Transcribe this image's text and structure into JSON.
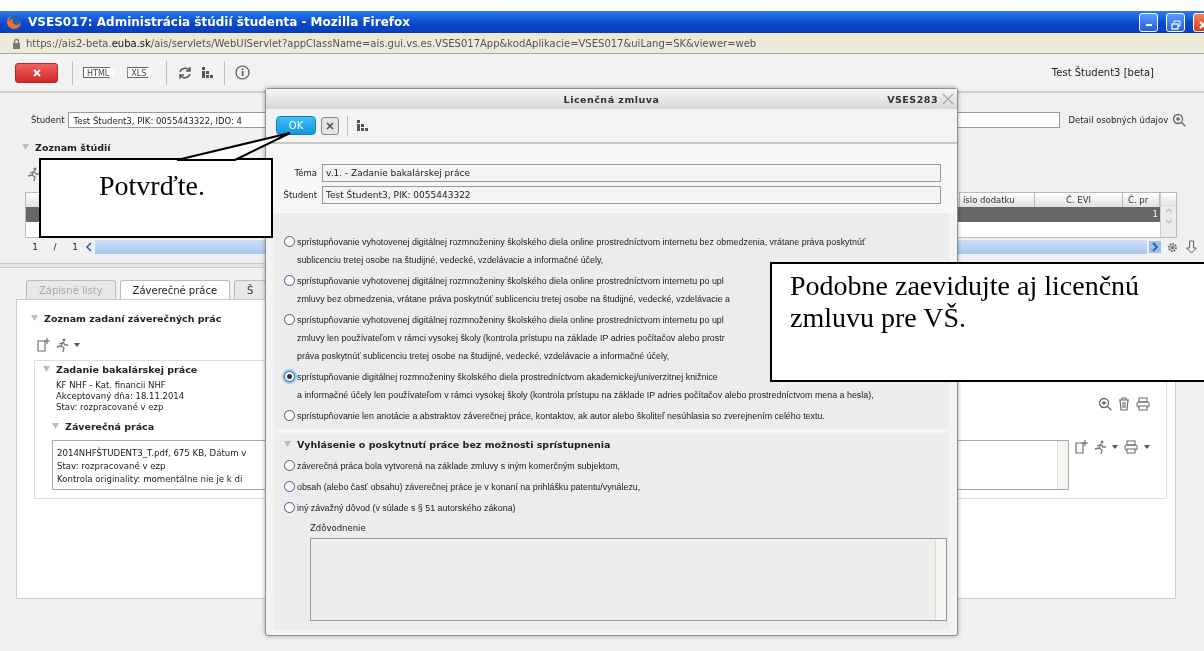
{
  "window": {
    "title": "VSES017: Administrácia štúdií študenta - Mozilla Firefox"
  },
  "address_bar": {
    "url": "https://ais2-beta.**euba.sk**/ais/servlets/WebUIServlet?appClassName=ais.gui.vs.es.VSES017App&kodAplikacie=VSES017&uiLang=SK&viewer=web"
  },
  "toolbar": {
    "items": [
      {
        "kind": "close"
      },
      {
        "kind": "separator"
      },
      {
        "kind": "tag",
        "label": "HTML"
      },
      {
        "kind": "tag",
        "label": "XLS"
      },
      {
        "kind": "separator"
      },
      {
        "kind": "refresh"
      },
      {
        "kind": "tree"
      },
      {
        "kind": "separator"
      },
      {
        "kind": "info"
      }
    ],
    "user": "Test Študent3 [beta]"
  },
  "student": {
    "label": "Študent",
    "value": "Test Študent3, PIK: 0055443322, IDO: 4",
    "detail_link": "Detail osobných údajov"
  },
  "studies": {
    "title": "Zoznam štúdií",
    "columns": [
      "íslo dodatku",
      "Č. EVI",
      "Č. pr"
    ],
    "rows": [
      {
        "column_3": "1",
        "selected": true
      },
      {
        "selected": false
      }
    ],
    "pager": {
      "page": "1",
      "separator": "/",
      "total": "1"
    }
  },
  "tabs": [
    {
      "label": "Zápisné listy",
      "selected": false,
      "disabled": true
    },
    {
      "label": "Záverečné práce",
      "selected": true,
      "disabled": false
    },
    {
      "label": "Š",
      "selected": false,
      "disabled": false
    }
  ],
  "theses": {
    "title": "Zoznam zadaní záverečných prác",
    "assignment": {
      "title": "Zadanie bakalárskej práce",
      "lines": [
        "KF NHF - Kat. financii NHF",
        "Akceptovaný dňa: 18.11.2014",
        "Stav: rozpracované v ezp"
      ],
      "thesis": {
        "title": "Záverečná práca",
        "lines": [
          "2014NHFŠTUDENT3_T.pdf, 675 KB, Dátum v",
          "Stav: rozpracované v ezp",
          "Kontrola originality: momentálne nie je k di"
        ]
      }
    }
  },
  "dialog": {
    "title": "Licenčná zmluva",
    "code": "VSES283",
    "ok_label": "OK",
    "fields": [
      {
        "label": "Téma",
        "value": "v.1. - Zadanie bakalárskej práce"
      },
      {
        "label": "Študent",
        "value": "Test Študent3, PIK: 0055443322"
      }
    ],
    "license_options": [
      {
        "selected": false,
        "lines": [
          "sprístupňovanie vyhotovenej digitálnej rozmnoženiny školského diela online prostredníctvom internetu bez obmedzenia, vrátane práva poskytnúť",
          "sublicenciu tretej osobe na študijné, vedecké, vzdelávacie a informačné účely,"
        ]
      },
      {
        "selected": false,
        "lines": [
          "sprístupňovanie vyhotovenej digitálnej rozmnoženiny školského diela online prostredníctvom internetu po upl",
          "zmluvy bez obmedzenia, vrátane práva poskytnúť sublicenciu tretej osobe na študijné, vedecké, vzdelávacie a"
        ]
      },
      {
        "selected": false,
        "lines": [
          "sprístupňovanie vyhotovenej digitálnej rozmnoženiny školského diela online prostredníctvom internetu po upl",
          "zmluvy len používateľom v rámci vysokej školy (kontrola prístupu na základe IP adries počítačov alebo prostr",
          "práva poskytnúť sublicenciu tretej osobe na študijné, vedecké, vzdelávacie a informačné účely,"
        ]
      },
      {
        "selected": true,
        "lines": [
          "sprístupňovanie digitálnej rozmnoženiny školského diela prostredníctvom akademickej/univerzitnej knižnice",
          "a informačné účely len používateľom v rámci vysokej školy (kontrola prístupu na základe IP adries počítačov alebo prostredníctvom mena a hesla),"
        ]
      },
      {
        "selected": false,
        "lines": [
          "sprístupňovanie len anotácie a abstraktov záverečnej práce, kontaktov, ak autor alebo školiteľ nesúhlasia so zverejnením celého textu."
        ]
      }
    ],
    "declaration": {
      "title": "Vyhlásenie o poskytnutí práce bez možnosti sprístupnenia",
      "options": [
        {
          "selected": false,
          "text": "záverečná práca bola vytvorená na základe zmluvy s iným komerčným subjektom,"
        },
        {
          "selected": false,
          "text": "obsah (alebo časť obsahu) záverečnej práce je v konaní na prihlášku patentu/vynálezu,"
        },
        {
          "selected": false,
          "text": "iný závažný dôvod (v súlade s § 51 autorského zákona)"
        }
      ],
      "reason_label": "Zdôvodnenie"
    }
  },
  "callouts": [
    {
      "text": "Potvrďte."
    },
    {
      "text": "Podobne zaevidujte aj licenčnú zmluvu pre VŠ."
    }
  ]
}
